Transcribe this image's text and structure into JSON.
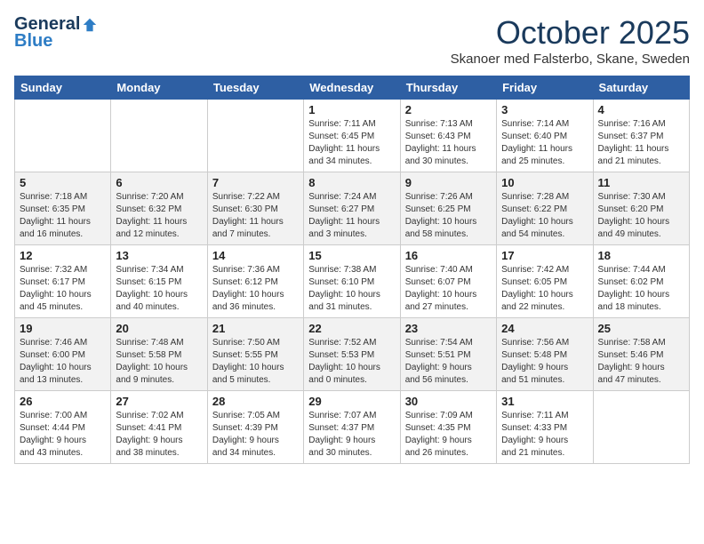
{
  "logo": {
    "general": "General",
    "blue": "Blue"
  },
  "title": "October 2025",
  "location": "Skanoer med Falsterbo, Skane, Sweden",
  "weekdays": [
    "Sunday",
    "Monday",
    "Tuesday",
    "Wednesday",
    "Thursday",
    "Friday",
    "Saturday"
  ],
  "weeks": [
    [
      {
        "day": "",
        "info": ""
      },
      {
        "day": "",
        "info": ""
      },
      {
        "day": "",
        "info": ""
      },
      {
        "day": "1",
        "info": "Sunrise: 7:11 AM\nSunset: 6:45 PM\nDaylight: 11 hours\nand 34 minutes."
      },
      {
        "day": "2",
        "info": "Sunrise: 7:13 AM\nSunset: 6:43 PM\nDaylight: 11 hours\nand 30 minutes."
      },
      {
        "day": "3",
        "info": "Sunrise: 7:14 AM\nSunset: 6:40 PM\nDaylight: 11 hours\nand 25 minutes."
      },
      {
        "day": "4",
        "info": "Sunrise: 7:16 AM\nSunset: 6:37 PM\nDaylight: 11 hours\nand 21 minutes."
      }
    ],
    [
      {
        "day": "5",
        "info": "Sunrise: 7:18 AM\nSunset: 6:35 PM\nDaylight: 11 hours\nand 16 minutes."
      },
      {
        "day": "6",
        "info": "Sunrise: 7:20 AM\nSunset: 6:32 PM\nDaylight: 11 hours\nand 12 minutes."
      },
      {
        "day": "7",
        "info": "Sunrise: 7:22 AM\nSunset: 6:30 PM\nDaylight: 11 hours\nand 7 minutes."
      },
      {
        "day": "8",
        "info": "Sunrise: 7:24 AM\nSunset: 6:27 PM\nDaylight: 11 hours\nand 3 minutes."
      },
      {
        "day": "9",
        "info": "Sunrise: 7:26 AM\nSunset: 6:25 PM\nDaylight: 10 hours\nand 58 minutes."
      },
      {
        "day": "10",
        "info": "Sunrise: 7:28 AM\nSunset: 6:22 PM\nDaylight: 10 hours\nand 54 minutes."
      },
      {
        "day": "11",
        "info": "Sunrise: 7:30 AM\nSunset: 6:20 PM\nDaylight: 10 hours\nand 49 minutes."
      }
    ],
    [
      {
        "day": "12",
        "info": "Sunrise: 7:32 AM\nSunset: 6:17 PM\nDaylight: 10 hours\nand 45 minutes."
      },
      {
        "day": "13",
        "info": "Sunrise: 7:34 AM\nSunset: 6:15 PM\nDaylight: 10 hours\nand 40 minutes."
      },
      {
        "day": "14",
        "info": "Sunrise: 7:36 AM\nSunset: 6:12 PM\nDaylight: 10 hours\nand 36 minutes."
      },
      {
        "day": "15",
        "info": "Sunrise: 7:38 AM\nSunset: 6:10 PM\nDaylight: 10 hours\nand 31 minutes."
      },
      {
        "day": "16",
        "info": "Sunrise: 7:40 AM\nSunset: 6:07 PM\nDaylight: 10 hours\nand 27 minutes."
      },
      {
        "day": "17",
        "info": "Sunrise: 7:42 AM\nSunset: 6:05 PM\nDaylight: 10 hours\nand 22 minutes."
      },
      {
        "day": "18",
        "info": "Sunrise: 7:44 AM\nSunset: 6:02 PM\nDaylight: 10 hours\nand 18 minutes."
      }
    ],
    [
      {
        "day": "19",
        "info": "Sunrise: 7:46 AM\nSunset: 6:00 PM\nDaylight: 10 hours\nand 13 minutes."
      },
      {
        "day": "20",
        "info": "Sunrise: 7:48 AM\nSunset: 5:58 PM\nDaylight: 10 hours\nand 9 minutes."
      },
      {
        "day": "21",
        "info": "Sunrise: 7:50 AM\nSunset: 5:55 PM\nDaylight: 10 hours\nand 5 minutes."
      },
      {
        "day": "22",
        "info": "Sunrise: 7:52 AM\nSunset: 5:53 PM\nDaylight: 10 hours\nand 0 minutes."
      },
      {
        "day": "23",
        "info": "Sunrise: 7:54 AM\nSunset: 5:51 PM\nDaylight: 9 hours\nand 56 minutes."
      },
      {
        "day": "24",
        "info": "Sunrise: 7:56 AM\nSunset: 5:48 PM\nDaylight: 9 hours\nand 51 minutes."
      },
      {
        "day": "25",
        "info": "Sunrise: 7:58 AM\nSunset: 5:46 PM\nDaylight: 9 hours\nand 47 minutes."
      }
    ],
    [
      {
        "day": "26",
        "info": "Sunrise: 7:00 AM\nSunset: 4:44 PM\nDaylight: 9 hours\nand 43 minutes."
      },
      {
        "day": "27",
        "info": "Sunrise: 7:02 AM\nSunset: 4:41 PM\nDaylight: 9 hours\nand 38 minutes."
      },
      {
        "day": "28",
        "info": "Sunrise: 7:05 AM\nSunset: 4:39 PM\nDaylight: 9 hours\nand 34 minutes."
      },
      {
        "day": "29",
        "info": "Sunrise: 7:07 AM\nSunset: 4:37 PM\nDaylight: 9 hours\nand 30 minutes."
      },
      {
        "day": "30",
        "info": "Sunrise: 7:09 AM\nSunset: 4:35 PM\nDaylight: 9 hours\nand 26 minutes."
      },
      {
        "day": "31",
        "info": "Sunrise: 7:11 AM\nSunset: 4:33 PM\nDaylight: 9 hours\nand 21 minutes."
      },
      {
        "day": "",
        "info": ""
      }
    ]
  ]
}
